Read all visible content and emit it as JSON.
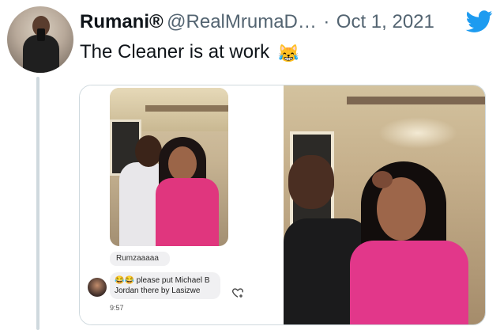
{
  "tweet": {
    "display_name": "Rumani®",
    "handle": "@RealMrumaD…",
    "separator": "·",
    "date": "Oct 1, 2021",
    "text": "The Cleaner is at work",
    "emoji": "😹"
  },
  "media": {
    "left_image": {
      "reply_bubble": "Rumzaaaaa",
      "message": "😂😂 please put Michael B Jordan there by Lasizwe",
      "time": "9:57"
    }
  },
  "icons": {
    "twitter_logo_color": "#1d9bf0",
    "thread_line_color": "#cfd9de"
  }
}
